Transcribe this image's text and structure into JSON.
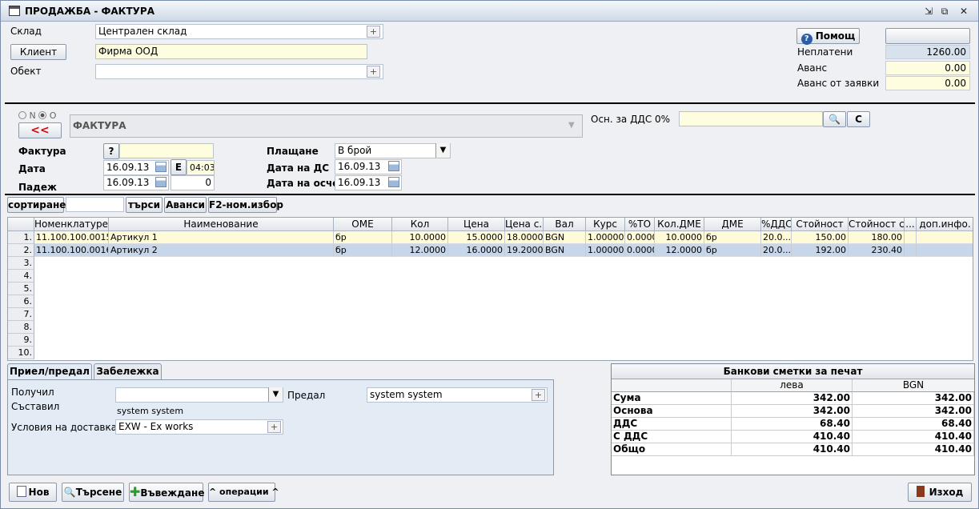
{
  "window": {
    "title": "ПРОДАЖБА - ФАКТУРА"
  },
  "header": {
    "warehouse_label": "Склад",
    "warehouse_value": "Централен склад",
    "client_button": "Клиент",
    "client_value": "Фирма ООД",
    "object_label": "Обект",
    "object_value": "",
    "help_button": "Помощ",
    "unpaid_label": "Неплатени",
    "unpaid_value": "1260.00",
    "advance_label": "Аванс",
    "advance_value": "0.00",
    "advance_orders_label": "Аванс от заявки",
    "advance_orders_value": "0.00"
  },
  "doc": {
    "radio_n": "N",
    "radio_o": "O",
    "back_button": "<<",
    "doc_type": "ФАКТУРА",
    "vat_basis_label": "Осн. за ДДС 0%",
    "vat_basis_value": "",
    "vat_basis_button": "С",
    "invoice_label": "Фактура",
    "invoice_q": "?",
    "invoice_value": "",
    "date_label": "Дата",
    "date_value": "16.09.13",
    "e_button": "E",
    "time_value": "04:03",
    "due_label": "Падеж",
    "due_value": "16.09.13",
    "due_days": "0",
    "payment_label": "Плащане",
    "payment_value": "В брой",
    "tax_date_label": "Дата на ДС",
    "tax_date_value": "16.09.13",
    "accounting_date_label": "Дата на осчет.",
    "accounting_date_value": "16.09.13"
  },
  "toolbar": {
    "sort_button": "сортиране",
    "sort_value": "",
    "search_button": "търси",
    "advances_button": "Аванси",
    "f2_button": "F2-ном.избор"
  },
  "grid": {
    "columns": [
      "Номенклатуре...",
      "Наименование",
      "ОМЕ",
      "Кол",
      "Цена",
      "Цена с...",
      "Вал",
      "Курс",
      "%ТО",
      "Кол.ДМЕ",
      "ДМЕ",
      "%ДДС",
      "Стойност",
      "Стойност с...",
      "...",
      "доп.инфо."
    ],
    "rows": [
      [
        "11.100.100.0015",
        "Артикул 1",
        "бр",
        "10.0000",
        "15.0000",
        "18.0000",
        "BGN",
        "1.000000",
        "0.0000",
        "10.0000",
        "бр",
        "20.0...",
        "150.00",
        "180.00",
        "",
        ""
      ],
      [
        "11.100.100.0016",
        "Артикул 2",
        "бр",
        "12.0000",
        "16.0000",
        "19.2000",
        "BGN",
        "1.000000",
        "0.0000",
        "12.0000",
        "бр",
        "20.0...",
        "192.00",
        "230.40",
        "",
        ""
      ]
    ],
    "row_numbers": [
      "1.",
      "2.",
      "3.",
      "4.",
      "5.",
      "6.",
      "7.",
      "8.",
      "9.",
      "10."
    ]
  },
  "tabs": {
    "tab1": "Приел/предал",
    "tab2": "Забележка",
    "received_label": "Получил",
    "received_value": "",
    "composed_label": "Съставил",
    "composed_value": "system system",
    "delivery_label": "Условия на доставка",
    "delivery_value": "EXW - Ex works",
    "handed_label": "Предал",
    "handed_value": "system system"
  },
  "bank": {
    "title": "Банкови сметки за печат",
    "col1": "лева",
    "col2": "BGN",
    "rows": [
      {
        "label": "Сума",
        "v1": "342.00",
        "v2": "342.00"
      },
      {
        "label": "Основа",
        "v1": "342.00",
        "v2": "342.00"
      },
      {
        "label": "ДДС",
        "v1": "68.40",
        "v2": "68.40"
      },
      {
        "label": "С ДДС",
        "v1": "410.40",
        "v2": "410.40"
      },
      {
        "label": "Общо",
        "v1": "410.40",
        "v2": "410.40"
      }
    ]
  },
  "footer": {
    "new_button": "Нов",
    "search_button": "Търсене",
    "enter_button": "Въвеждане",
    "operations_button": "^ операции ^",
    "exit_button": "Изход"
  }
}
